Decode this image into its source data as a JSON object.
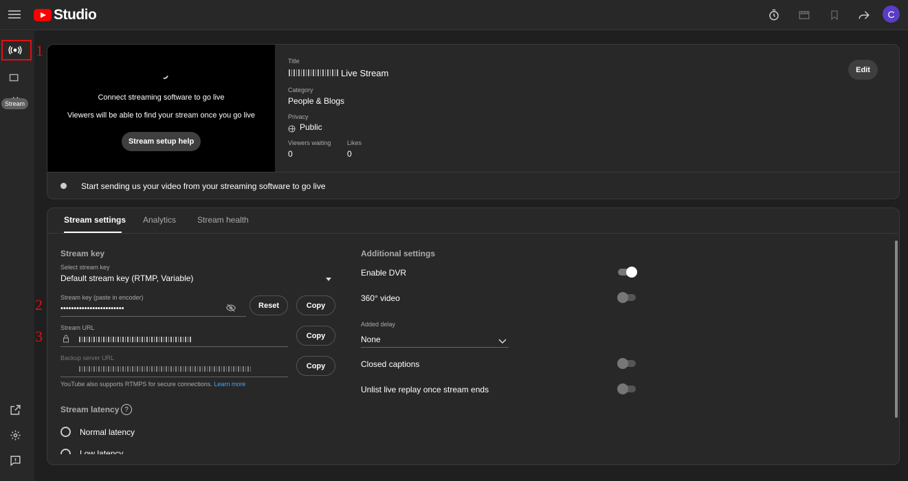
{
  "header": {
    "logo_text": "Studio",
    "icons": [
      "menu-icon",
      "timer-icon",
      "clapperboard-icon",
      "bookmark-icon",
      "share-icon"
    ],
    "avatar_letter": "C"
  },
  "sidebar": {
    "tooltip": "Stream",
    "icons": [
      "stream-icon",
      "camera-icon",
      "calendar-icon",
      "external-link-icon",
      "gear-icon",
      "feedback-icon"
    ]
  },
  "annotations": [
    "1",
    "2",
    "3"
  ],
  "preview": {
    "line1": "Connect streaming software to go live",
    "line2": "Viewers will be able to find your stream once you go live",
    "help_button": "Stream setup help"
  },
  "details": {
    "title_label": "Title",
    "title_value": "Live Stream",
    "category_label": "Category",
    "category_value": "People & Blogs",
    "privacy_label": "Privacy",
    "privacy_value": "Public",
    "viewers_label": "Viewers waiting",
    "viewers_value": "0",
    "likes_label": "Likes",
    "likes_value": "0",
    "edit_button": "Edit"
  },
  "status_text": "Start sending us your video from your streaming software to go live",
  "tabs": [
    {
      "label": "Stream settings",
      "active": true
    },
    {
      "label": "Analytics",
      "active": false
    },
    {
      "label": "Stream health",
      "active": false
    }
  ],
  "stream_key": {
    "section_title": "Stream key",
    "select_label": "Select stream key",
    "select_value": "Default stream key (RTMP, Variable)",
    "key_label": "Stream key (paste in encoder)",
    "key_value": "••••••••••••••••••••••••",
    "reset_button": "Reset",
    "copy_button": "Copy",
    "url_label": "Stream URL",
    "url_copy_button": "Copy",
    "backup_label": "Backup server URL",
    "backup_copy_button": "Copy",
    "rtmps_note": "YouTube also supports RTMPS for secure connections.",
    "learn_more": "Learn more"
  },
  "latency": {
    "section_title": "Stream latency",
    "normal": "Normal latency",
    "low": "Low latency"
  },
  "additional": {
    "section_title": "Additional settings",
    "dvr_label": "Enable DVR",
    "dvr_on": true,
    "video360_label": "360° video",
    "video360_on": false,
    "delay_label": "Added delay",
    "delay_value": "None",
    "captions_label": "Closed captions",
    "captions_on": false,
    "unlist_label": "Unlist live replay once stream ends",
    "unlist_on": false
  }
}
